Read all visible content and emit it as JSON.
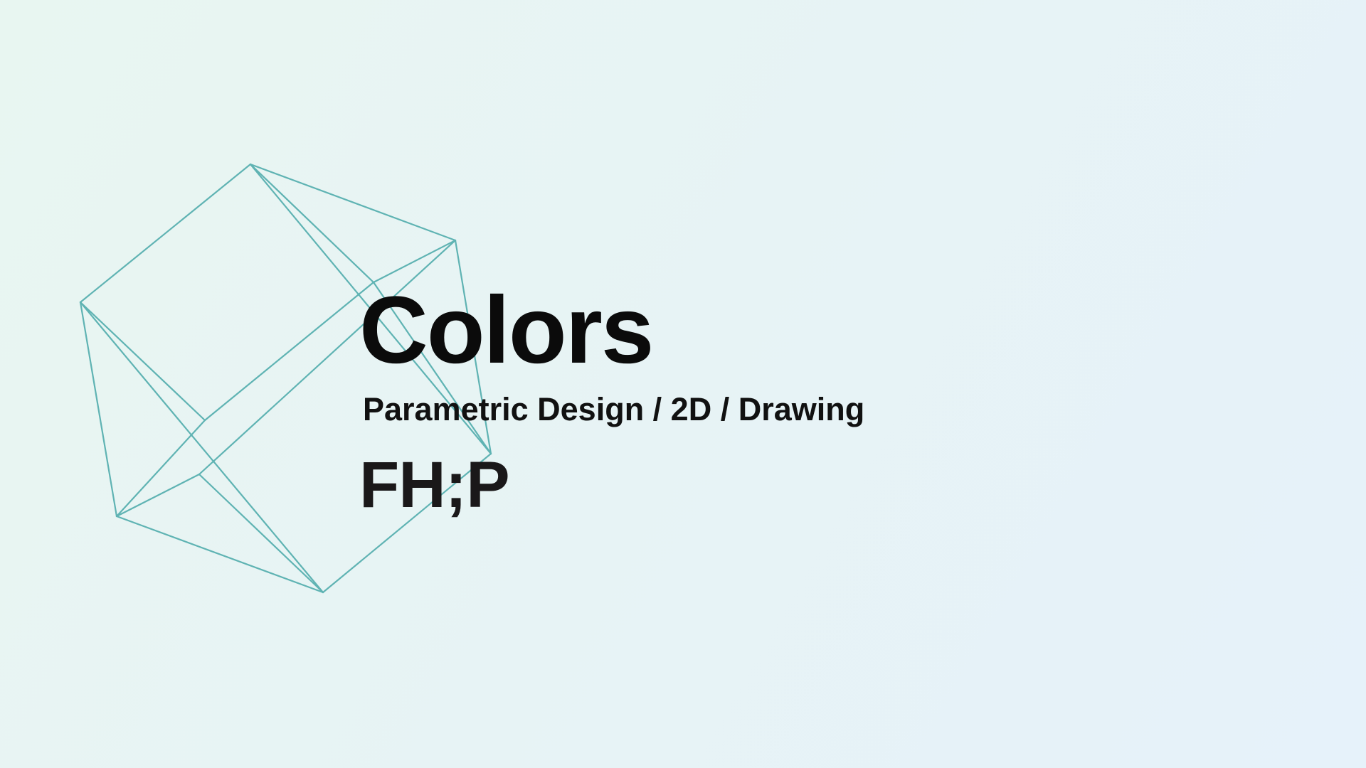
{
  "cover": {
    "title": "Colors",
    "subtitle": "Parametric Design / 2D / Drawing",
    "logo_text": "FH;P"
  },
  "colors": {
    "background_start": "#e8f6f1",
    "background_end": "#e6f2fa",
    "wireframe_stroke": "#5fb3b3",
    "text": "#0b0b0b"
  },
  "graphic": {
    "icon": "wireframe-polyhedron-icon"
  }
}
